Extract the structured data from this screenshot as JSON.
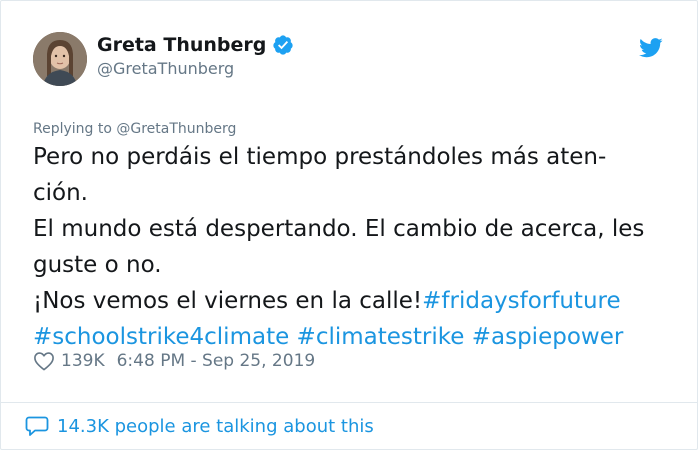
{
  "author": {
    "display_name": "Greta Thunberg",
    "handle": "@GretaThunberg",
    "verified_icon": "verified-badge-icon",
    "avatar_icon": "avatar"
  },
  "platform_icon": "twitter-bird-icon",
  "reply": {
    "text": "Replying to @GretaThunberg"
  },
  "tweet": {
    "line1": "Pero no perdáis el tiempo prestándoles más aten-",
    "line2": "ción.",
    "line3": "El mundo está despertando. El cambio de acerca, les",
    "line4": "guste o no.",
    "line5_text": "¡Nos vemos el viernes en la calle!",
    "hashtag1": "#fridaysforfuture",
    "hashtag2": "#schoolstrike4climate",
    "hashtag3": "#climatestrike",
    "hashtag4": "#aspiepower"
  },
  "meta": {
    "likes": "139K",
    "timestamp": "6:48 PM - Sep 25, 2019"
  },
  "footer": {
    "talking": "14.3K people are talking about this"
  },
  "colors": {
    "link": "#1b95e0",
    "secondary": "#657786",
    "text": "#14171a",
    "border": "#e1e8ed"
  }
}
